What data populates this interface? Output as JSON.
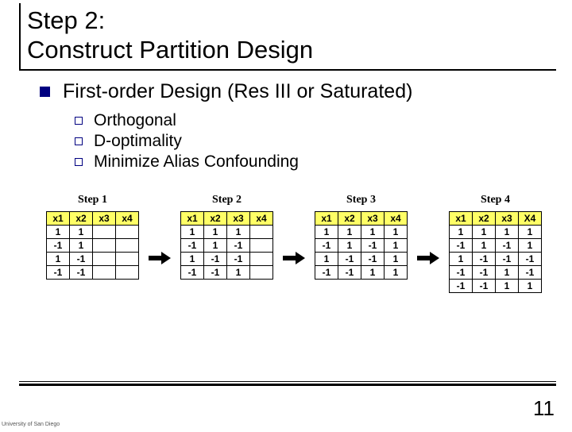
{
  "title_line1": "Step 2:",
  "title_line2": "Construct Partition Design",
  "level1_text": "First-order Design (Res III or Saturated)",
  "level2_items": [
    "Orthogonal",
    "D-optimality",
    "Minimize Alias Confounding"
  ],
  "steps": [
    {
      "title": "Step 1",
      "headers": [
        "x1",
        "x2",
        "x3",
        "x4"
      ],
      "rows": [
        [
          "1",
          "1",
          "",
          ""
        ],
        [
          "-1",
          "1",
          "",
          ""
        ],
        [
          "1",
          "-1",
          "",
          ""
        ],
        [
          "-1",
          "-1",
          "",
          ""
        ]
      ]
    },
    {
      "title": "Step 2",
      "headers": [
        "x1",
        "x2",
        "x3",
        "x4"
      ],
      "rows": [
        [
          "1",
          "1",
          "1",
          ""
        ],
        [
          "-1",
          "1",
          "-1",
          ""
        ],
        [
          "1",
          "-1",
          "-1",
          ""
        ],
        [
          "-1",
          "-1",
          "1",
          ""
        ]
      ]
    },
    {
      "title": "Step 3",
      "headers": [
        "x1",
        "x2",
        "x3",
        "x4"
      ],
      "rows": [
        [
          "1",
          "1",
          "1",
          "1"
        ],
        [
          "-1",
          "1",
          "-1",
          "1"
        ],
        [
          "1",
          "-1",
          "-1",
          "1"
        ],
        [
          "-1",
          "-1",
          "1",
          "1"
        ]
      ]
    },
    {
      "title": "Step 4",
      "headers": [
        "x1",
        "x2",
        "x3",
        "X4"
      ],
      "rows": [
        [
          "1",
          "1",
          "1",
          "1"
        ],
        [
          "-1",
          "1",
          "-1",
          "1"
        ],
        [
          "1",
          "-1",
          "-1",
          "-1"
        ],
        [
          "-1",
          "-1",
          "1",
          "-1"
        ],
        [
          "-1",
          "-1",
          "1",
          "1"
        ]
      ]
    }
  ],
  "page_number": "11",
  "logo_text": "University of San Diego"
}
